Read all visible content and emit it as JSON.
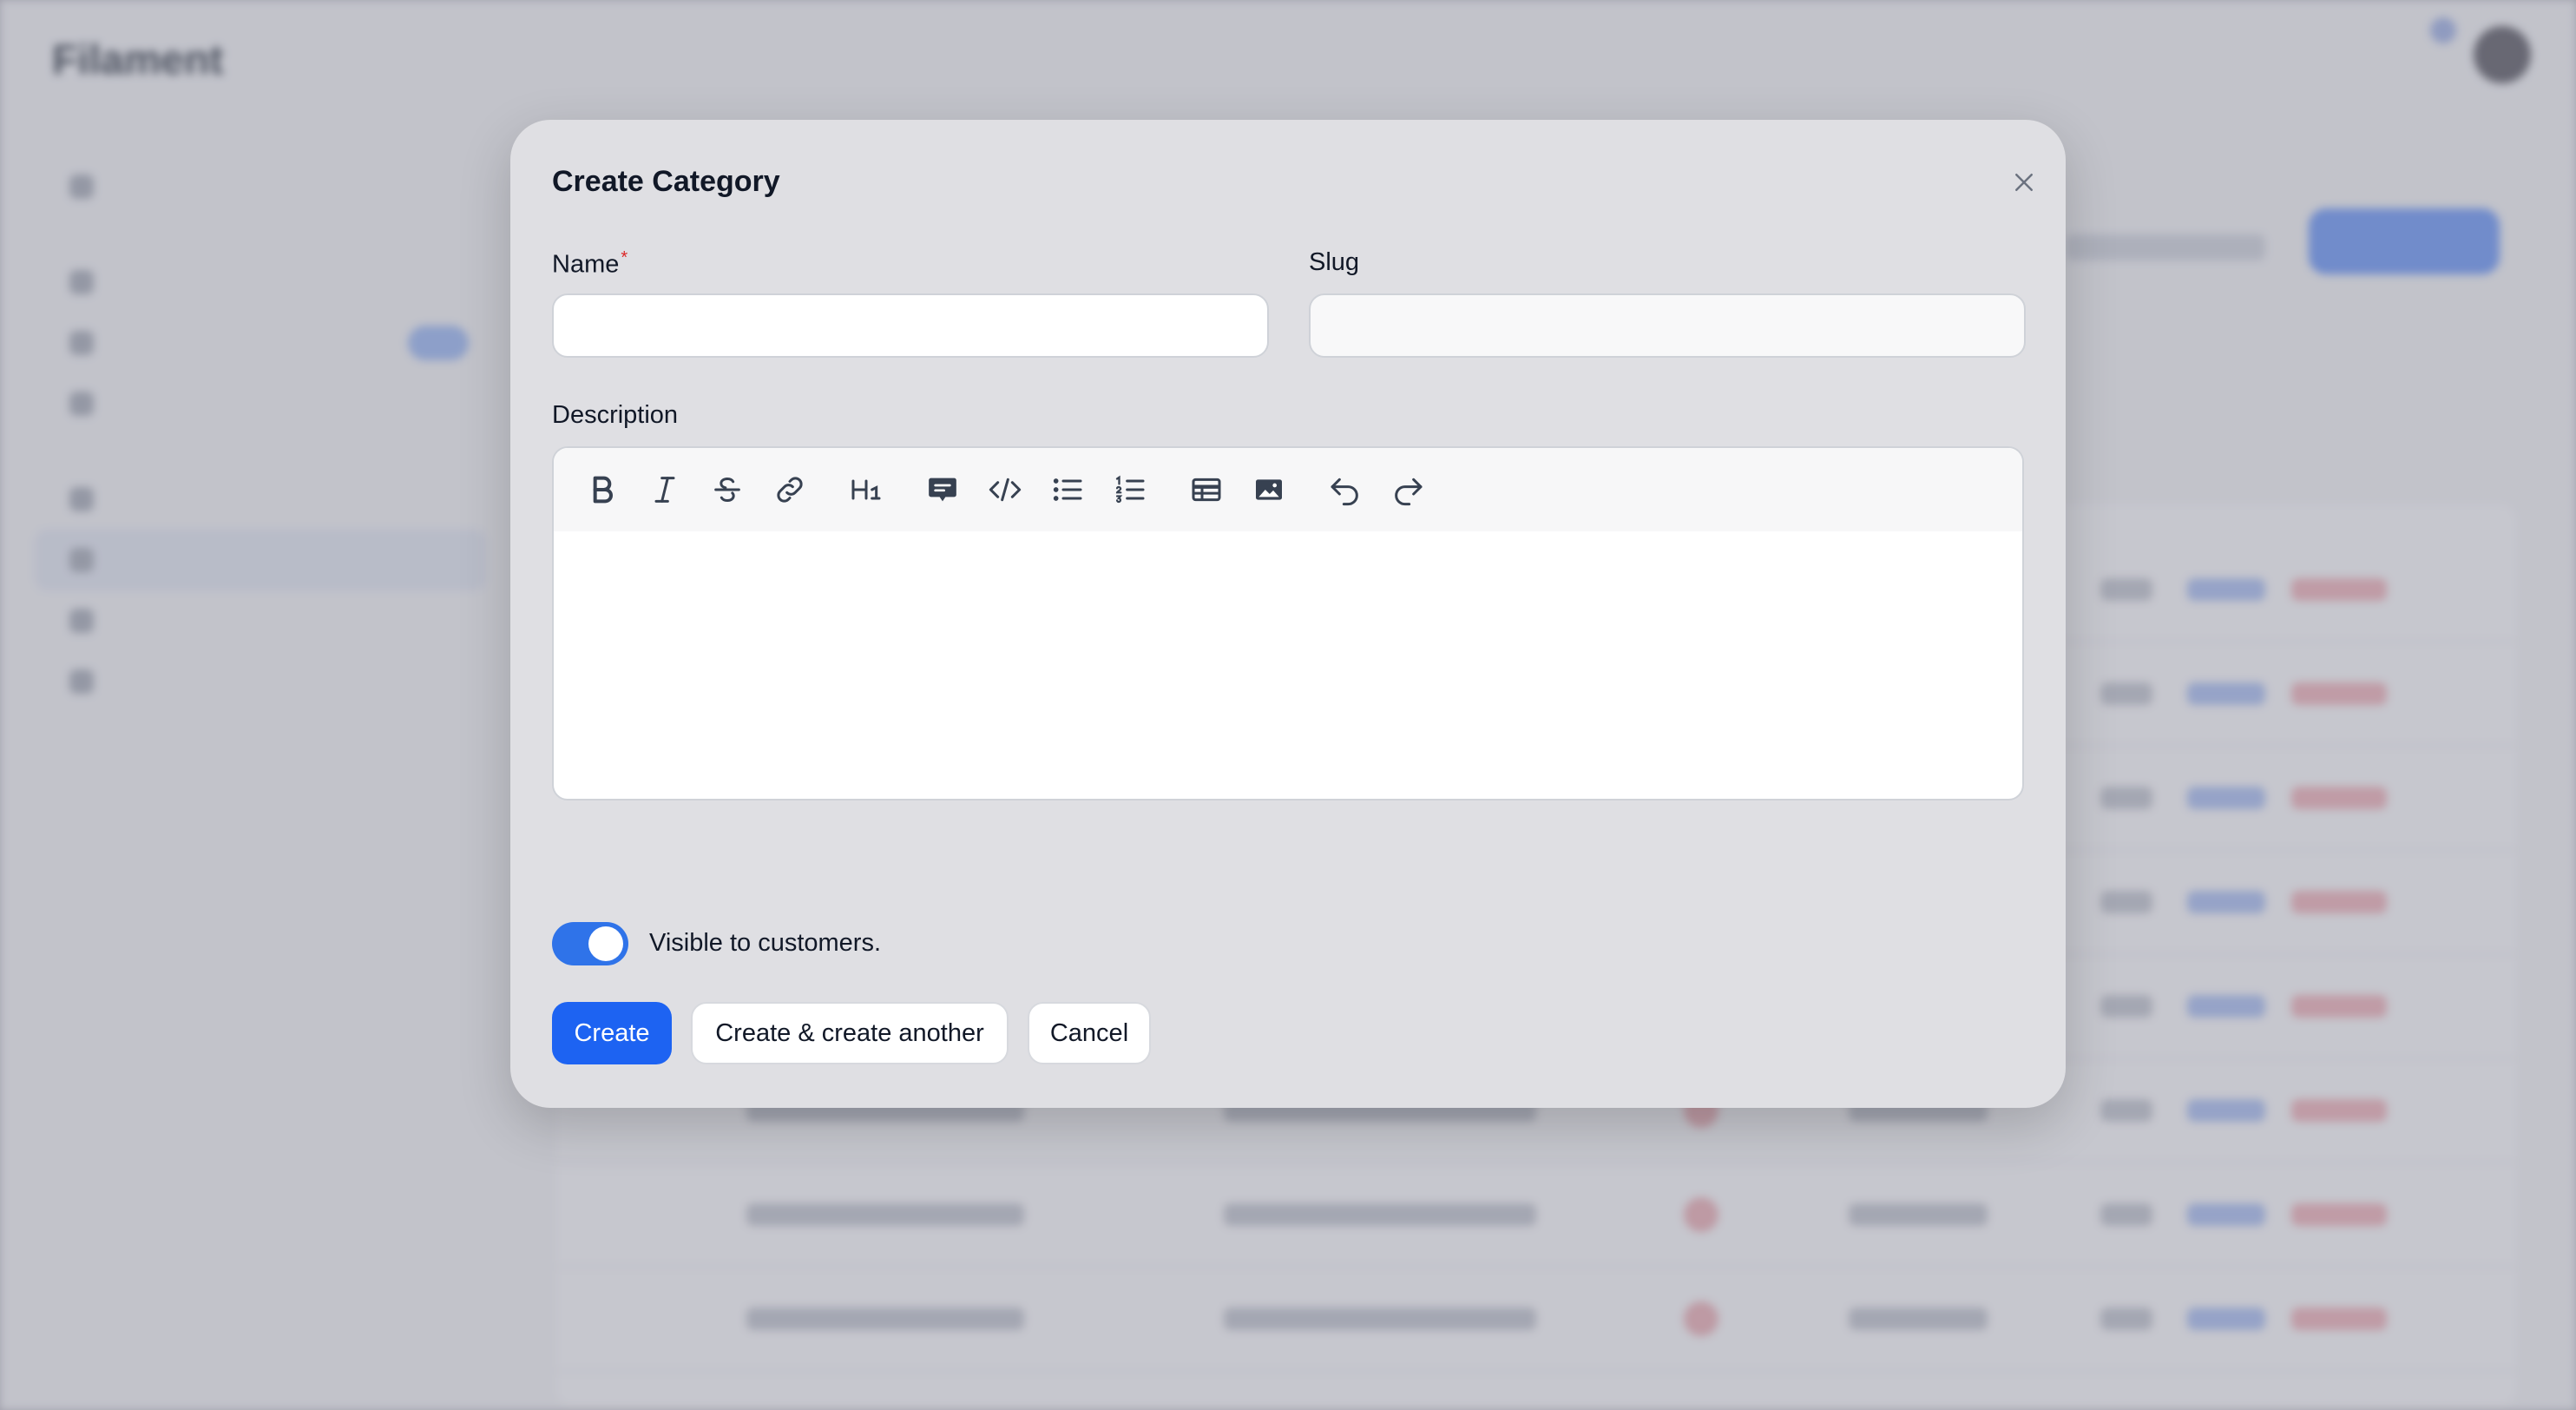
{
  "background_app": {
    "brand": "Filament"
  },
  "modal": {
    "title": "Create Category",
    "close_icon": "close-icon",
    "fields": {
      "name": {
        "label": "Name",
        "required_mark": "*",
        "value": "",
        "placeholder": ""
      },
      "slug": {
        "label": "Slug",
        "value": "",
        "placeholder": ""
      },
      "description": {
        "label": "Description",
        "value": ""
      }
    },
    "toolbar_icons": [
      "bold-icon",
      "italic-icon",
      "strikethrough-icon",
      "link-icon",
      "heading-icon",
      "blockquote-icon",
      "code-block-icon",
      "bullet-list-icon",
      "ordered-list-icon",
      "table-icon",
      "image-icon",
      "undo-icon",
      "redo-icon"
    ],
    "toggle": {
      "label": "Visible to customers.",
      "checked": true
    },
    "buttons": {
      "create": "Create",
      "create_another": "Create & create another",
      "cancel": "Cancel"
    }
  },
  "colors": {
    "primary": "#1d63f2",
    "toggle_on": "#2f73e9",
    "required": "#dc2626"
  }
}
